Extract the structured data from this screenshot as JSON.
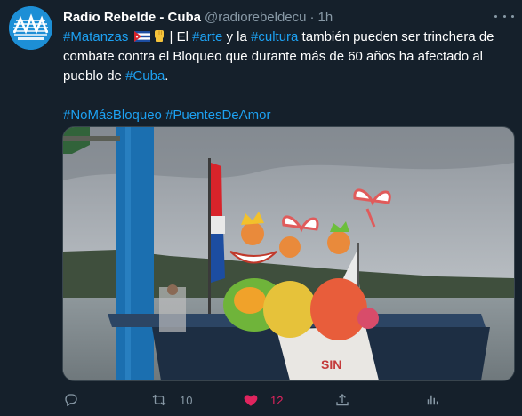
{
  "tweet": {
    "author_name": "Radio Rebelde - Cuba",
    "handle": "@radiorebeldecu",
    "separator": "·",
    "time": "1h",
    "text": {
      "tag_matanzas": "#Matanzas",
      "part1": "| El ",
      "tag_arte": "#arte",
      "part2": " y la ",
      "tag_cultura": "#cultura",
      "part3": " también pueden ser trinchera de combate contra el Bloqueo que durante más de 60 años ha afectado al pueblo de ",
      "tag_cuba": "#Cuba",
      "part4": ".",
      "tag_nomasbloqueo": "#NoMásBloqueo",
      "tag_puentesdeamor": "#PuentesDeAmor"
    },
    "media": {
      "banner_text": "SIN"
    },
    "actions": {
      "reply": {
        "icon": "reply-icon"
      },
      "retweet": {
        "icon": "retweet-icon",
        "count": "10"
      },
      "like": {
        "icon": "heart-icon",
        "count": "12",
        "active": true
      },
      "share": {
        "icon": "share-icon"
      },
      "analytics": {
        "icon": "analytics-icon"
      }
    },
    "colors": {
      "background": "#15202b",
      "link": "#1da1f2",
      "muted": "#8899a6",
      "like_active": "#e0245e"
    }
  }
}
